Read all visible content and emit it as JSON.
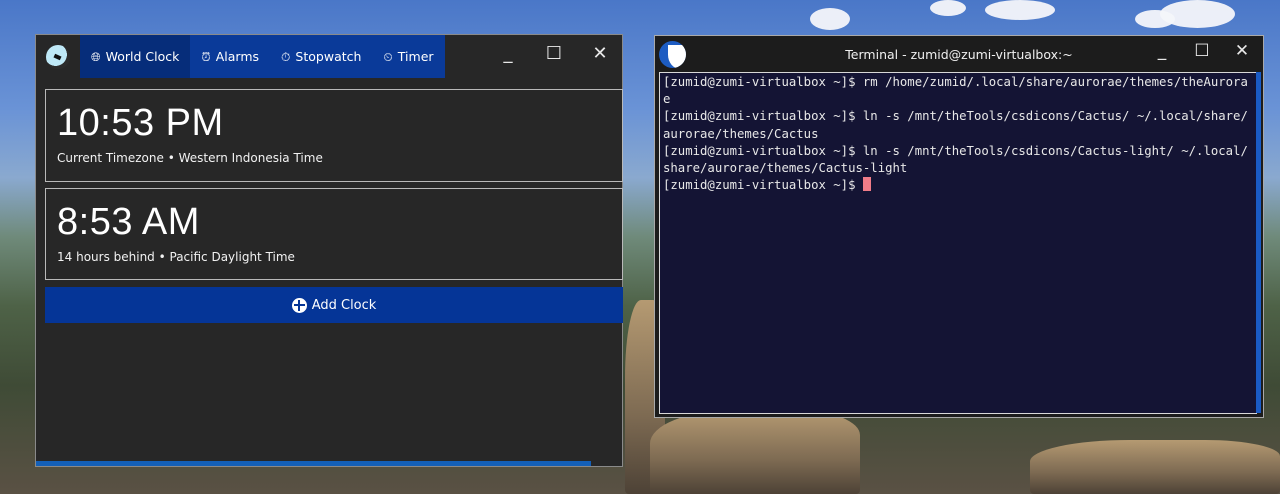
{
  "clock_app": {
    "tabs": [
      {
        "label": "World Clock",
        "icon": "globe-icon"
      },
      {
        "label": "Alarms",
        "icon": "alarm-icon"
      },
      {
        "label": "Stopwatch",
        "icon": "stopwatch-icon"
      },
      {
        "label": "Timer",
        "icon": "timer-icon"
      }
    ],
    "clocks": [
      {
        "time": "10:53 PM",
        "subtitle": "Current Timezone • Western Indonesia Time"
      },
      {
        "time": "8:53 AM",
        "subtitle": "14 hours behind • Pacific Daylight Time"
      }
    ],
    "add_clock_label": "Add Clock",
    "colors": {
      "accent": "#053597",
      "background": "#272727"
    }
  },
  "terminal": {
    "title": "Terminal - zumid@zumi-virtualbox:~",
    "lines": [
      "[zumid@zumi-virtualbox ~]$ rm /home/zumid/.local/share/aurorae/themes/theAurorae",
      "[zumid@zumi-virtualbox ~]$ ln -s /mnt/theTools/csdicons/Cactus/ ~/.local/share/aurorae/themes/Cactus",
      "[zumid@zumi-virtualbox ~]$ ln -s /mnt/theTools/csdicons/Cactus-light/ ~/.local/share/aurorae/themes/Cactus-light"
    ],
    "prompt": "[zumid@zumi-virtualbox ~]$ ",
    "colors": {
      "background": "#141434",
      "cursor": "#f07c88"
    }
  }
}
